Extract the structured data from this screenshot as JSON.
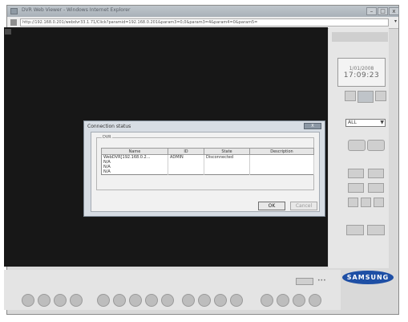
{
  "window": {
    "title": "DVR Web Viewer - Windows Internet Explorer",
    "url": "http://192.168.0.201/webdvr33.1.71/Click?paramid=192.168.0.201&param3=0,0&param3=4&param4=0&param5="
  },
  "clock": {
    "date": "1/01/2008",
    "time": "17:09:23"
  },
  "channel_select": {
    "value": "ALL"
  },
  "logo": {
    "text": "SAMSUNG"
  },
  "dialog": {
    "title": "Connection status",
    "close_label": "X",
    "group_label": "DVR",
    "columns": [
      "Name",
      "ID",
      "State",
      "Description"
    ],
    "rows": [
      {
        "name": "WebDVR[192.168.0.2...",
        "id": "ADMIN",
        "state": "Disconnected",
        "description": ""
      },
      {
        "name": "N/A",
        "id": "",
        "state": "",
        "description": ""
      },
      {
        "name": "N/A",
        "id": "",
        "state": "",
        "description": ""
      },
      {
        "name": "N/A",
        "id": "",
        "state": "",
        "description": ""
      }
    ],
    "ok_label": "OK",
    "cancel_label": "Cancel"
  }
}
